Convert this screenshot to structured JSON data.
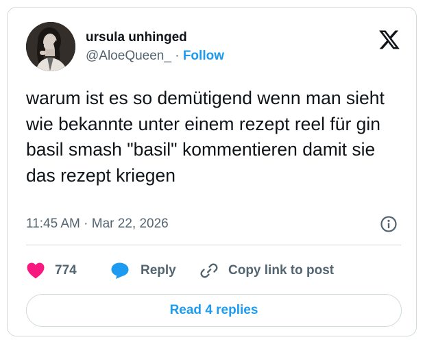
{
  "user": {
    "display_name": "ursula unhinged",
    "handle": "@AloeQueen_",
    "separator": " · ",
    "follow_label": "Follow"
  },
  "brand": {
    "logo_icon": "x-logo-icon"
  },
  "tweet": {
    "text": "warum ist es so demütigend wenn man sieht wie bekannte unter einem rezept reel für gin basil smash \"basil\" kommentieren damit sie das rezept kriegen",
    "timestamp": "11:45 AM · Mar 22, 2026"
  },
  "actions": {
    "like_count": "774",
    "reply_label": "Reply",
    "copy_link_label": "Copy link to post"
  },
  "footer": {
    "read_replies_label": "Read 4 replies"
  },
  "colors": {
    "accent": "#1d9bf0",
    "like": "#f91880",
    "text_primary": "#0f1419",
    "text_secondary": "#536471",
    "border": "#cfd9de"
  }
}
